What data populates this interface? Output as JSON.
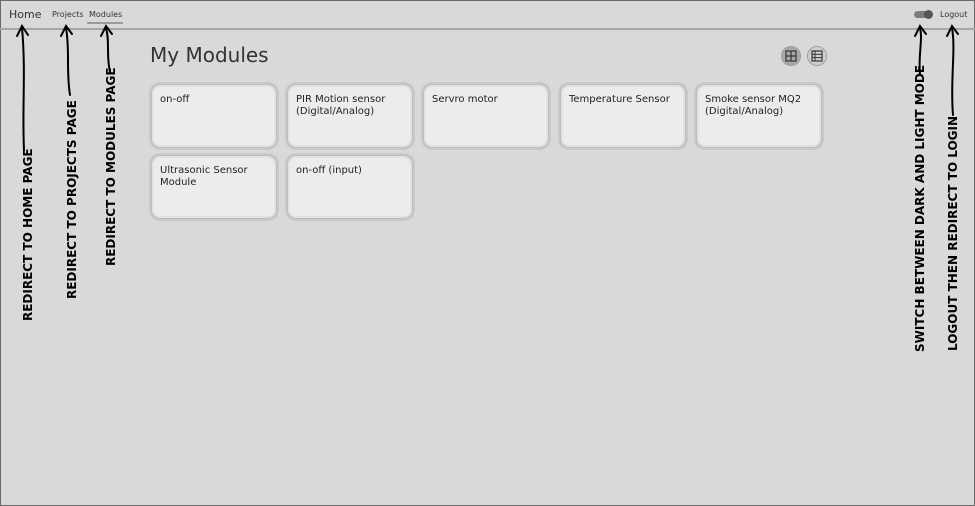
{
  "nav": {
    "home": "Home",
    "projects": "Projects",
    "modules": "Modules",
    "logout": "Logout"
  },
  "theme_toggle": {
    "icon": "toggle-switch-icon"
  },
  "main": {
    "title": "My Modules",
    "view_buttons": [
      {
        "icon": "grid-view-icon",
        "active": true
      },
      {
        "icon": "list-view-icon",
        "active": false
      }
    ],
    "modules": [
      "on-off",
      "PIR Motion sensor (Digital/Analog)",
      "Servro motor",
      "Temperature Sensor",
      "Smoke sensor MQ2 (Digital/Analog)",
      "Ultrasonic Sensor Module",
      "on-off (input)"
    ]
  },
  "annotations": {
    "home": "REDIRECT TO HOME PAGE",
    "projects": "REDIRECT TO PROJECTS PAGE",
    "modules": "REDIRECT TO MODULES PAGE",
    "theme": "SWITCH BETWEEN DARK AND LIGHT MODE",
    "logout": "LOGOUT THEN REDIRECT TO LOGIN"
  }
}
